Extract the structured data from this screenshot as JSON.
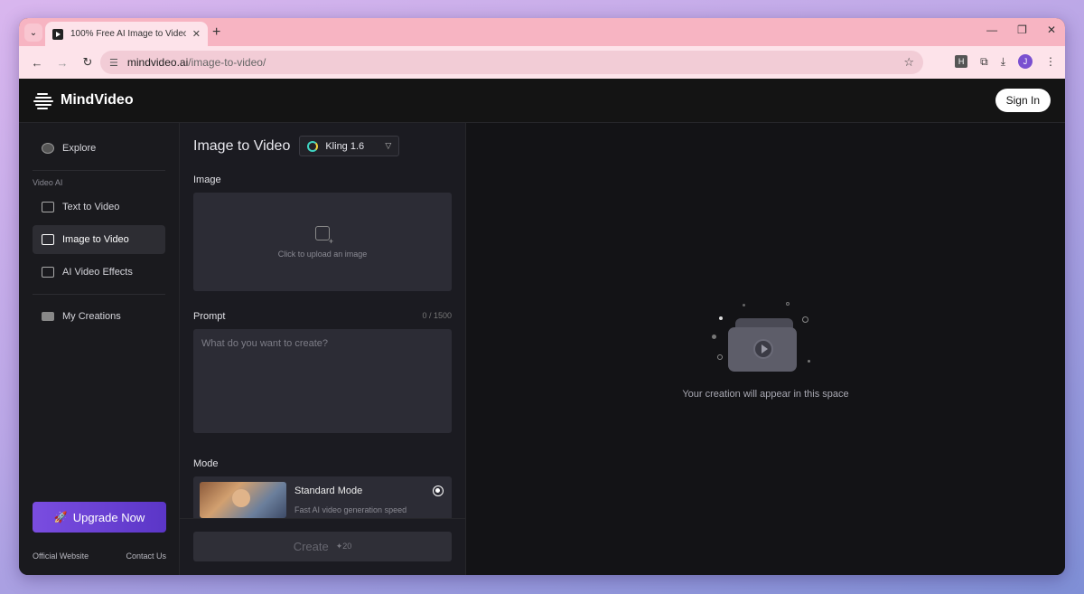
{
  "browser": {
    "tab_title": "100% Free AI Image to Video C",
    "url_host": "mindvideo.ai",
    "url_path": "/image-to-video/",
    "extension_label": "H",
    "profile_initial": "J"
  },
  "header": {
    "brand": "MindVideo",
    "sign_in": "Sign In"
  },
  "sidebar": {
    "explore": "Explore",
    "section_label": "Video AI",
    "items": [
      {
        "label": "Text to Video"
      },
      {
        "label": "Image to Video"
      },
      {
        "label": "AI Video Effects"
      }
    ],
    "my_creations": "My Creations",
    "upgrade": "Upgrade Now",
    "footer_links": [
      "Official Website",
      "Contact Us"
    ]
  },
  "form": {
    "title": "Image to Video",
    "model": "Kling 1.6",
    "image_label": "Image",
    "upload_text": "Click to upload an image",
    "prompt_label": "Prompt",
    "prompt_counter": "0 / 1500",
    "prompt_placeholder": "What do you want to create?",
    "mode_label": "Mode",
    "mode_name": "Standard Mode",
    "mode_desc": "Fast AI video generation speed",
    "create_label": "Create",
    "create_cost": "20"
  },
  "preview": {
    "empty_text": "Your creation will appear in this space"
  },
  "colors": {
    "accent": "#6b44d8",
    "tab_bar": "#f7b4c2"
  }
}
